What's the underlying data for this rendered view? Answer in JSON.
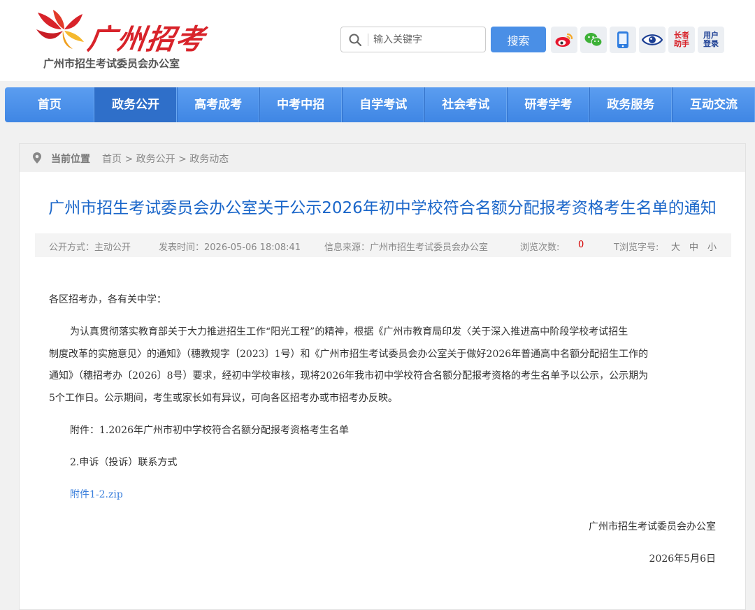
{
  "header": {
    "logo_text": "广州招考",
    "logo_subtitle": "广州市招生考试委员会办公室",
    "search_placeholder": "输入关键字",
    "search_button": "搜索",
    "tools": {
      "elder": "长者助手",
      "elder_1": "长者",
      "elder_2": "助手",
      "login_1": "用户",
      "login_2": "登录"
    }
  },
  "nav": {
    "items": [
      {
        "label": "首页"
      },
      {
        "label": "政务公开"
      },
      {
        "label": "高考成考"
      },
      {
        "label": "中考中招"
      },
      {
        "label": "自学考试"
      },
      {
        "label": "社会考试"
      },
      {
        "label": "研考学考"
      },
      {
        "label": "政务服务"
      },
      {
        "label": "互动交流"
      }
    ],
    "active_index": 1
  },
  "breadcrumb": {
    "label": "当前位置",
    "items": [
      "首页",
      "政务公开",
      "政务动态"
    ],
    "separator": ">"
  },
  "article": {
    "title": "广州市招生考试委员会办公室关于公示2026年初中学校符合名额分配报考资格考生名单的通知",
    "meta": {
      "mode": "公开方式：主动公开",
      "date": "发表时间：2026-05-06 18:08:41",
      "source": "信息来源：广州市招生考试委员会办公室",
      "views_label": "浏览次数:",
      "views": "0",
      "font_label": "T浏览字号:",
      "font_sizes": [
        "大",
        "中",
        "小"
      ]
    },
    "greeting": "各区招考办，各有关中学：",
    "body_lines": [
      "为认真贯彻落实教育部关于大力推进招生工作“阳光工程”的精神，根据《广州市教育局印发〈关于深入推进高中阶段学校考试招生",
      "制度改革的实施意见〉的通知》（穗教规字〔2023〕1号）和《广州市招生考试委员会办公室关于做好2026年普通高中名额分配招生工作的",
      "通知》（穗招考办〔2026〕8号）要求，经初中学校审核，现将2026年我市初中学校符合名额分配报考资格的考生名单予以公示，公示期为",
      "5个工作日。公示期间，考生或家长如有异议，可向各区招考办或市招考办反映。"
    ],
    "attachment_1": "附件：1.2026年广州市初中学校符合名额分配报考资格考生名单",
    "attachment_2": "2.申诉（投诉）联系方式",
    "attachment_link": "附件1-2.zip",
    "signature": "广州市招生考试委员会办公室",
    "sign_date": "2026年5月6日"
  },
  "colors": {
    "brand_red": "#d8232a",
    "nav_blue": "#4a8fe6",
    "title_blue": "#1a66c9",
    "views_red": "#d40000"
  }
}
